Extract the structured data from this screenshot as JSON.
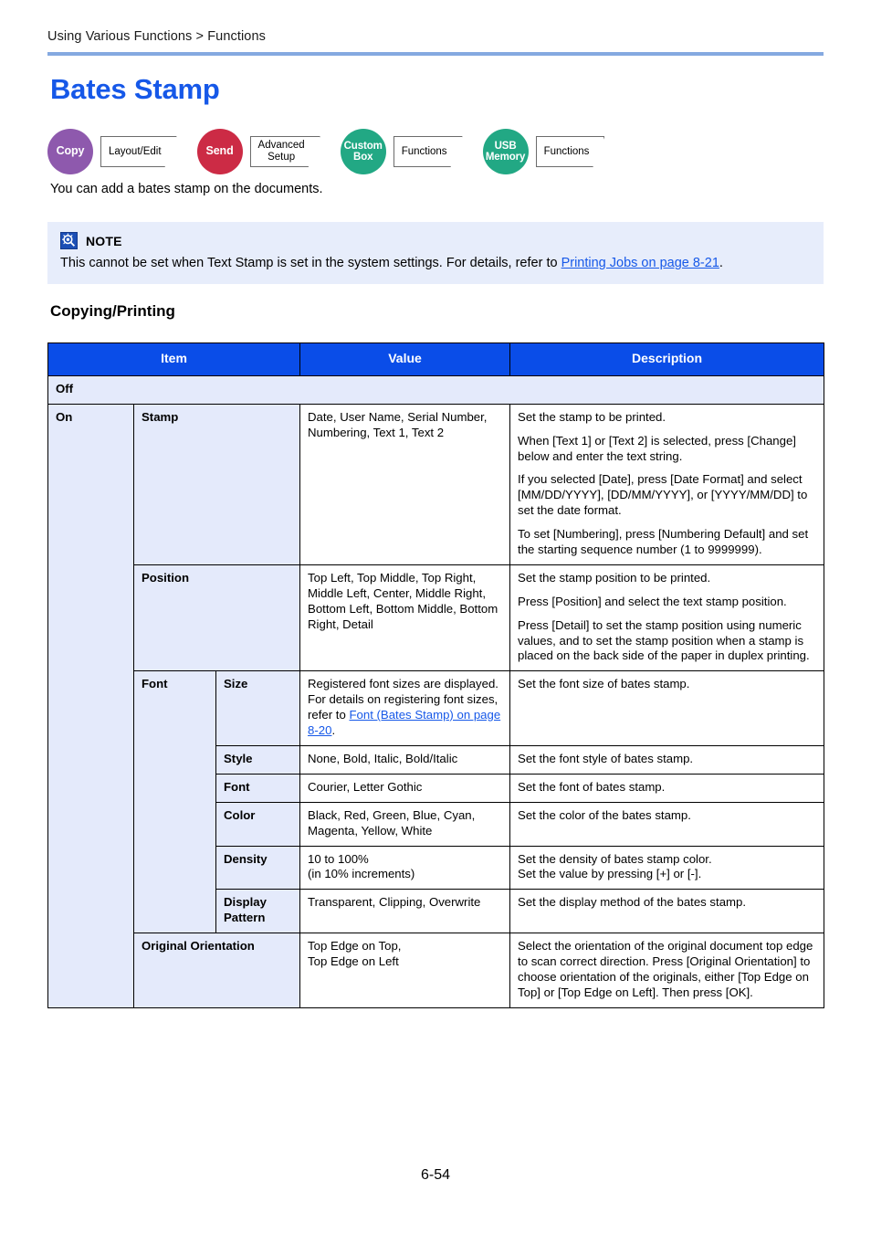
{
  "header": {
    "breadcrumb": "Using Various Functions > Functions",
    "title": "Bates Stamp"
  },
  "badges": [
    {
      "circle_label": "Copy",
      "circle_color": "#8e59ad",
      "tag_label": "Layout/Edit",
      "icon": "copy-badge-icon"
    },
    {
      "circle_label": "Send",
      "circle_color": "#cc2b45",
      "tag_label": "Advanced\nSetup",
      "icon": "send-badge-icon"
    },
    {
      "circle_label": "Custom\nBox",
      "circle_color": "#22a884",
      "tag_label": "Functions",
      "icon": "custom-box-badge-icon"
    },
    {
      "circle_label": "USB\nMemory",
      "circle_color": "#22a884",
      "tag_label": "Functions",
      "icon": "usb-memory-badge-icon"
    }
  ],
  "intro": "You can add a bates stamp on the documents.",
  "note": {
    "icon": "magnifier-note-icon",
    "label": "NOTE",
    "text_before": "This cannot be set when Text Stamp is set in the system settings. For details, refer to ",
    "link_text": "Printing Jobs on page 8-21",
    "text_after": "."
  },
  "section_heading": "Copying/Printing",
  "table": {
    "columns": [
      "Item",
      "Value",
      "Description"
    ],
    "off_row_label": "Off",
    "on_row_label": "On",
    "rows": [
      {
        "item": "Stamp",
        "value": "Date, User Name, Serial Number, Numbering, Text 1, Text 2",
        "description": [
          "Set the stamp to be printed.",
          "When [Text 1] or [Text 2] is selected, press [Change] below and enter the text string.",
          "If you selected [Date], press [Date Format] and select [MM/DD/YYYY], [DD/MM/YYYY], or [YYYY/MM/DD] to set the date format.",
          "To set [Numbering], press [Numbering Default] and set the starting sequence number (1 to 9999999)."
        ]
      },
      {
        "item": "Position",
        "value": "Top Left, Top Middle, Top Right, Middle Left, Center, Middle Right, Bottom Left, Bottom Middle, Bottom Right, Detail",
        "description": [
          "Set the stamp position to be printed.",
          "Press [Position] and select the text stamp position.",
          "Press [Detail] to set the stamp position using numeric values, and to set the stamp position when a stamp is placed on the back side of the paper in duplex printing."
        ]
      }
    ],
    "font_group": {
      "label": "Font",
      "subrows": [
        {
          "sub_item": "Size",
          "value_before": "Registered font sizes are displayed. For details on registering font sizes, refer to ",
          "value_link": "Font (Bates Stamp) on page 8-20",
          "value_after": ".",
          "description": "Set the font size of bates stamp."
        },
        {
          "sub_item": "Style",
          "value": "None, Bold, Italic, Bold/Italic",
          "description": "Set the font style of bates stamp."
        },
        {
          "sub_item": "Font",
          "value": "Courier, Letter Gothic",
          "description": "Set the font of bates stamp."
        },
        {
          "sub_item": "Color",
          "value": "Black, Red, Green, Blue, Cyan, Magenta, Yellow, White",
          "description": "Set the color of the bates stamp."
        },
        {
          "sub_item": "Density",
          "value_line1": "10 to 100%",
          "value_line2": "(in 10% increments)",
          "description_line1": "Set the density of bates stamp color.",
          "description_line2": "Set the value by pressing [+] or [-]."
        },
        {
          "sub_item": "Display Pattern",
          "value": "Transparent, Clipping, Overwrite",
          "description": "Set the display method of the bates stamp."
        }
      ]
    },
    "orientation_row": {
      "item": "Original Orientation",
      "value_line1": "Top Edge on Top,",
      "value_line2": "Top Edge on Left",
      "description": "Select the orientation of the original document top edge to scan correct direction. Press [Original Orientation] to choose orientation of the originals, either [Top Edge on Top] or [Top Edge on Left]. Then press [OK]."
    }
  },
  "footer": {
    "page_number": "6-54"
  },
  "colors": {
    "title_blue": "#1658e8",
    "rule_blue": "#85a9e0",
    "table_header_blue": "#0a4de8",
    "lavender_cell": "#e4eafb",
    "note_bg": "#e7edfb",
    "link_blue": "#1658e8"
  }
}
